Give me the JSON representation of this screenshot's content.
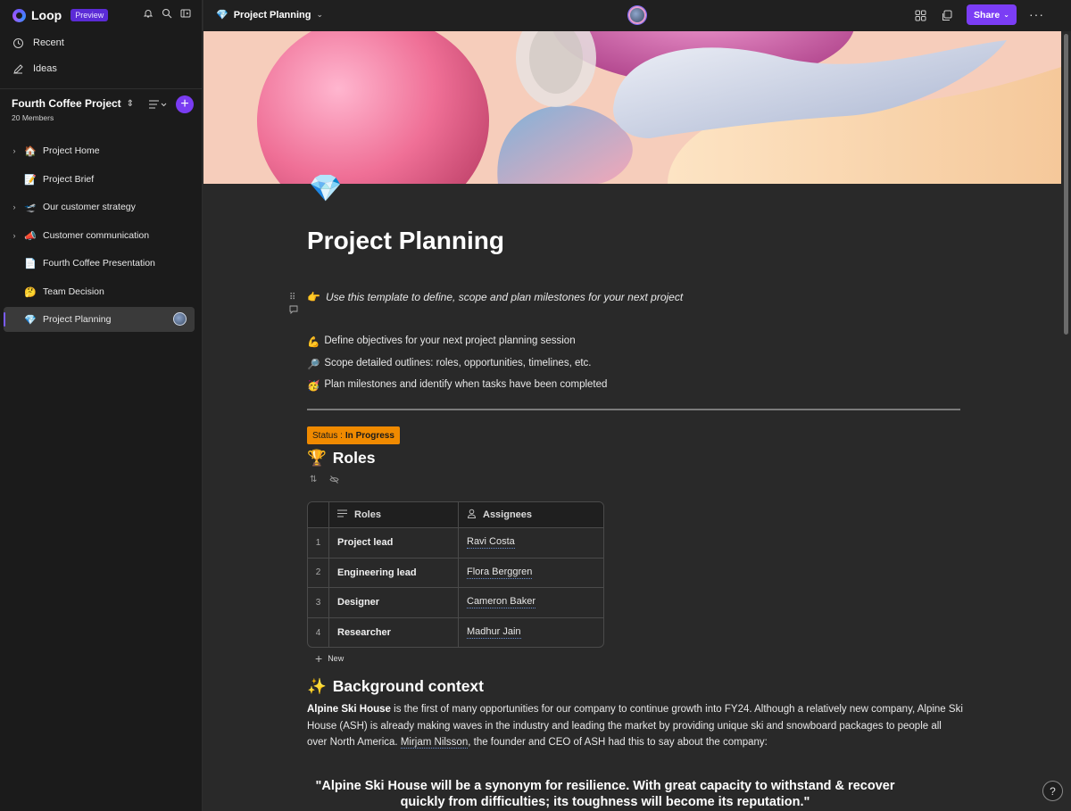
{
  "app": {
    "name": "Loop",
    "badge": "Preview"
  },
  "sidebar": {
    "nav": [
      {
        "label": "Recent",
        "icon": "clock-icon"
      },
      {
        "label": "Ideas",
        "icon": "pen-icon"
      }
    ],
    "workspace": {
      "title": "Fourth Coffee Project",
      "members": "20 Members"
    },
    "pages": [
      {
        "label": "Project Home",
        "emoji": "🏠",
        "expandable": true
      },
      {
        "label": "Project Brief",
        "emoji": "📝",
        "expandable": false
      },
      {
        "label": "Our customer strategy",
        "emoji": "🛫",
        "expandable": true
      },
      {
        "label": "Customer communication",
        "emoji": "📣",
        "expandable": true
      },
      {
        "label": "Fourth Coffee Presentation",
        "emoji": "📄",
        "expandable": false
      },
      {
        "label": "Team Decision",
        "emoji": "🤔",
        "expandable": false
      },
      {
        "label": "Project Planning",
        "emoji": "💎",
        "expandable": false,
        "active": true
      }
    ]
  },
  "topbar": {
    "breadcrumb": "Project Planning",
    "share_label": "Share"
  },
  "page": {
    "emoji": "💎",
    "title": "Project Planning",
    "intro": {
      "emoji": "👉",
      "text": "Use this template to define, scope and plan milestones for your next project"
    },
    "bullets": [
      {
        "emoji": "💪",
        "text": "Define objectives for your next project planning session"
      },
      {
        "emoji": "🔎",
        "text": "Scope detailed outlines: roles, opportunities, timelines, etc."
      },
      {
        "emoji": "🥳",
        "text": "Plan milestones and identify when tasks have been completed"
      }
    ],
    "status": {
      "label": "Status :",
      "value": "In Progress",
      "color": "#f08a00"
    },
    "roles_heading": {
      "emoji": "🏆",
      "text": "Roles"
    },
    "table": {
      "columns": [
        "Roles",
        "Assignees"
      ],
      "rows": [
        {
          "n": "1",
          "role": "Project lead",
          "assignee": "Ravi Costa"
        },
        {
          "n": "2",
          "role": "Engineering lead",
          "assignee": "Flora Berggren"
        },
        {
          "n": "3",
          "role": "Designer",
          "assignee": "Cameron Baker"
        },
        {
          "n": "4",
          "role": "Researcher",
          "assignee": "Madhur Jain"
        }
      ],
      "new_label": "New"
    },
    "background_heading": {
      "emoji": "✨",
      "text": "Background context"
    },
    "background": {
      "bold": "Alpine Ski House",
      "text1": " is the first of many opportunities for our company to continue growth into FY24. Although a relatively new company, Alpine Ski House (ASH) is already making waves in the industry and leading the market by providing unique ski and snowboard packages to people all over North America. ",
      "name": "Mirjam Nilsson",
      "text2": ", the founder and CEO of ASH had this to say about the company:"
    },
    "quote": "\"Alpine Ski House will be a synonym for resilience. With great capacity to withstand & recover quickly from difficulties; its toughness will become its reputation.\""
  },
  "colors": {
    "accent": "#7b3df5",
    "status": "#f08a00",
    "sidebar_bg": "#1b1b1b",
    "page_bg": "#292929"
  }
}
